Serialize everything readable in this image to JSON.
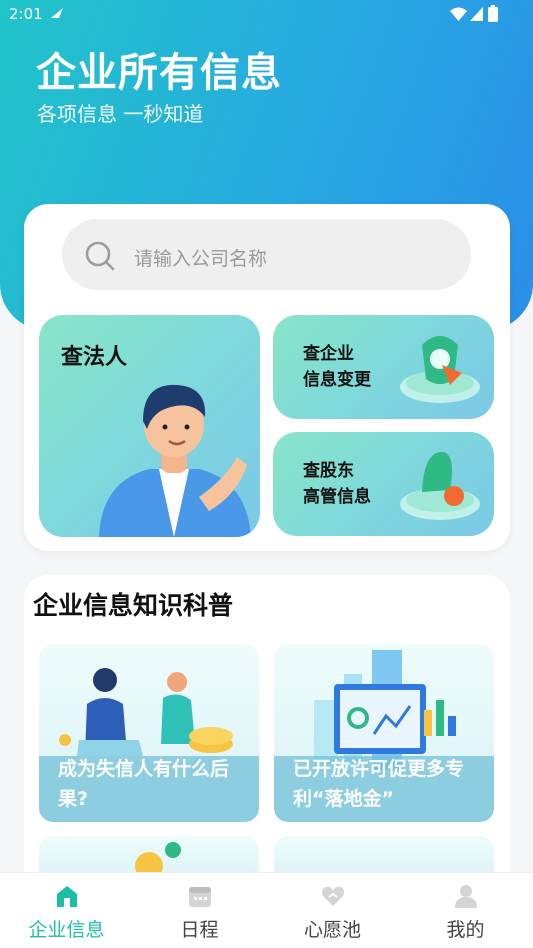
{
  "status_bar": {
    "time": "2:01"
  },
  "hero": {
    "title": "企业所有信息",
    "subtitle": "各项信息 一秒知道"
  },
  "search": {
    "placeholder": "请输入公司名称"
  },
  "query_tiles": {
    "legal_person": "查法人",
    "company_change": [
      "查企业",
      "信息变更"
    ],
    "shareholder": [
      "查股东",
      "高管信息"
    ]
  },
  "knowledge": {
    "title": "企业信息知识科普",
    "articles": [
      {
        "caption": "成为失信人有什么后果?"
      },
      {
        "caption": "已开放许可促更多专利“落地金”"
      }
    ]
  },
  "tabbar": {
    "tabs": [
      {
        "label": "企业信息",
        "icon": "home-icon",
        "active": true
      },
      {
        "label": "日程",
        "icon": "calendar-icon",
        "active": false
      },
      {
        "label": "心愿池",
        "icon": "heart-icon",
        "active": false
      },
      {
        "label": "我的",
        "icon": "user-icon",
        "active": false
      }
    ]
  },
  "colors": {
    "accent": "#1bbfa6",
    "hero_start": "#21c4c9",
    "hero_end": "#2a8ee8"
  }
}
